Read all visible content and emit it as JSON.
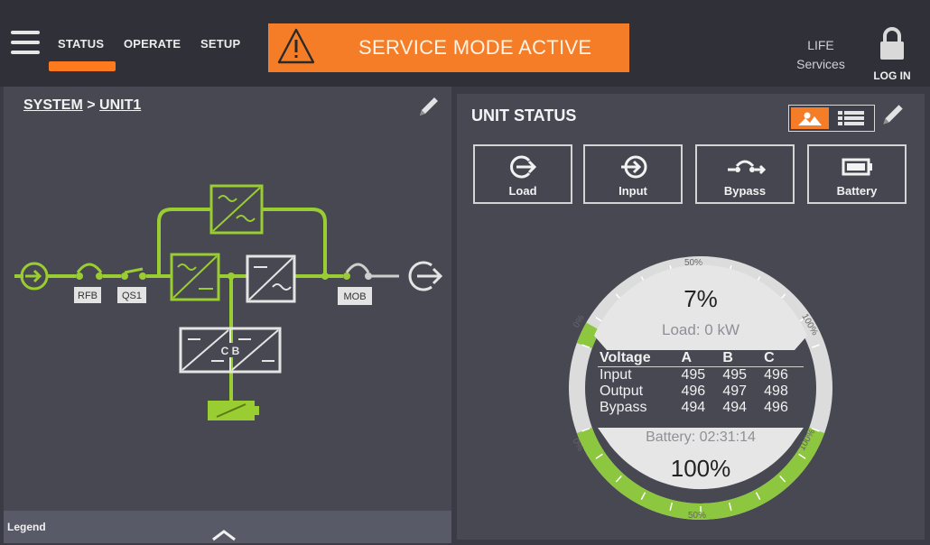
{
  "nav": {
    "tabs": [
      {
        "label": "STATUS",
        "active": true
      },
      {
        "label": "OPERATE",
        "active": false
      },
      {
        "label": "SETUP",
        "active": false
      }
    ]
  },
  "alert": {
    "text": "SERVICE MODE ACTIVE",
    "color": "#f57d28"
  },
  "life": {
    "line1": "LIFE",
    "line2": "Services"
  },
  "login": {
    "label": "LOG IN"
  },
  "system_panel": {
    "breadcrumb_root": "SYSTEM",
    "separator": ">",
    "breadcrumb_unit": "UNIT1",
    "labels": {
      "rfb": "RFB",
      "qs1": "QS1",
      "mob": "MOB",
      "cb": "C B"
    },
    "legend": "Legend"
  },
  "unit_status": {
    "title": "UNIT STATUS",
    "buttons": [
      {
        "label": "Load",
        "icon": "load-icon"
      },
      {
        "label": "Input",
        "icon": "input-icon"
      },
      {
        "label": "Bypass",
        "icon": "bypass-icon"
      },
      {
        "label": "Battery",
        "icon": "battery-icon"
      }
    ]
  },
  "gauge": {
    "load_percent": "7%",
    "load_text": "Load: 0 kW",
    "load_fraction": 0.07,
    "battery_text": "Battery: 02:31:14",
    "battery_percent": "100%",
    "battery_fraction": 1.0,
    "scale_labels": {
      "top_0": "0%",
      "top_50": "50%",
      "top_100": "100%",
      "bottom_0": "0%",
      "bottom_50": "50%",
      "bottom_100": "100%"
    },
    "voltage": {
      "headers": [
        "Voltage",
        "A",
        "B",
        "C"
      ],
      "rows": [
        {
          "label": "Input",
          "a": "495",
          "b": "495",
          "c": "496"
        },
        {
          "label": "Output",
          "a": "496",
          "b": "497",
          "c": "498"
        },
        {
          "label": "Bypass",
          "a": "494",
          "b": "494",
          "c": "496"
        }
      ]
    }
  },
  "colors": {
    "accent": "#f57d28",
    "flow_green": "#9acd32",
    "panel": "#474852"
  }
}
